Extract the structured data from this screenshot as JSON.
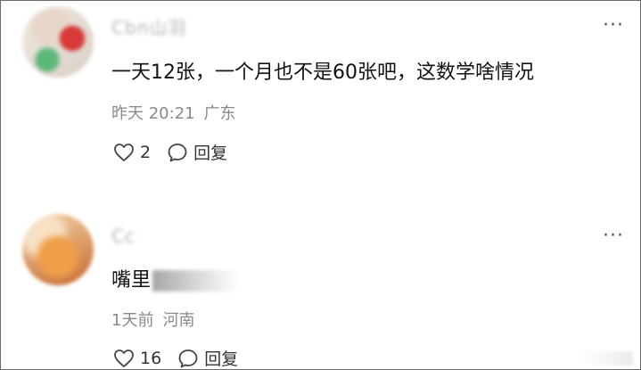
{
  "comments": [
    {
      "username": "Cbn山羽",
      "content": "一天12张，一个月也不是60张吧，这数学啥情况",
      "time": "昨天 20:21",
      "location": "广东",
      "like_count": "2",
      "reply_label": "回复",
      "more_label": "···"
    },
    {
      "username": "Cc",
      "content": "嘴里",
      "time": "1天前",
      "location": "河南",
      "like_count": "16",
      "reply_label": "回复",
      "more_label": "···"
    }
  ]
}
